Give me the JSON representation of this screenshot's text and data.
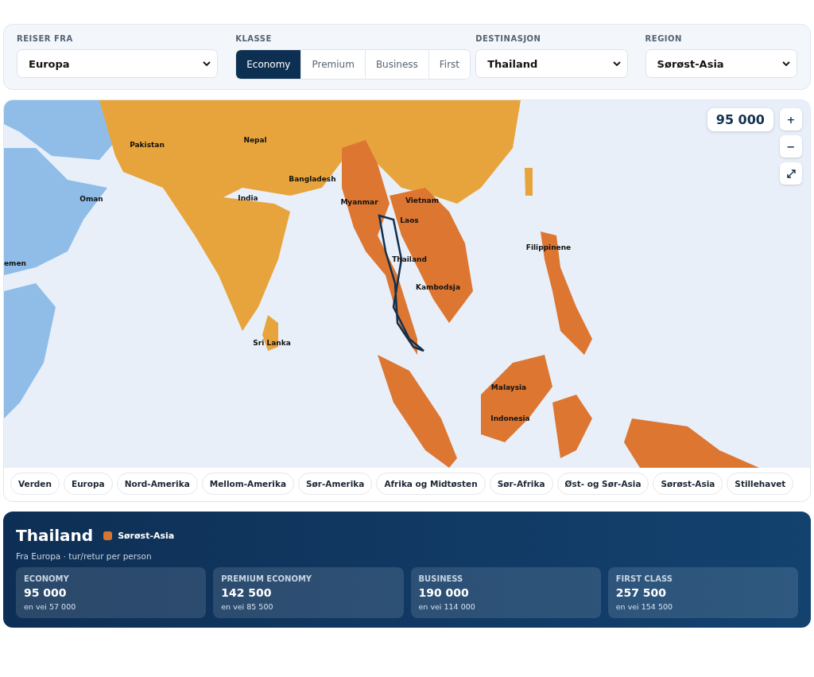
{
  "filters": {
    "origin": {
      "label": "REISER FRA",
      "value": "Europa"
    },
    "class": {
      "label": "KLASSE",
      "options": [
        {
          "label": "Economy",
          "selected": true
        },
        {
          "label": "Premium",
          "selected": false
        },
        {
          "label": "Business",
          "selected": false
        },
        {
          "label": "First",
          "selected": false
        }
      ]
    },
    "destination": {
      "label": "DESTINASJON",
      "value": "Thailand"
    },
    "region": {
      "label": "REGION",
      "value": "Sørøst-Asia"
    }
  },
  "map": {
    "price_badge": "95 000",
    "controls": [
      "+",
      "−"
    ],
    "labels": [
      "Pakistan",
      "Nepal",
      "Oman",
      "India",
      "Bangladesh",
      "Myanmar",
      "Vietnam",
      "Laos",
      "Thailand",
      "Kambodsja",
      "Filippinene",
      "emen",
      "Sri Lanka",
      "Malaysia",
      "Indonesia"
    ],
    "region_tabs": [
      {
        "label": "Verden",
        "selected": false
      },
      {
        "label": "Europa",
        "selected": false
      },
      {
        "label": "Nord-Amerika",
        "selected": false
      },
      {
        "label": "Mellom-Amerika",
        "selected": false
      },
      {
        "label": "Sør-Amerika",
        "selected": false
      },
      {
        "label": "Afrika og Midtøsten",
        "selected": false
      },
      {
        "label": "Sør-Afrika",
        "selected": false
      },
      {
        "label": "Øst- og Sør-Asia",
        "selected": false
      },
      {
        "label": "Sørøst-Asia",
        "selected": false
      },
      {
        "label": "Stillehavet",
        "selected": false
      }
    ]
  },
  "summary": {
    "title": "Thailand",
    "region": {
      "label": "Sørøst-Asia",
      "color": "#d9742f"
    },
    "subtitle": "Fra Europa · tur/retur per person",
    "prices": [
      {
        "label": "ECONOMY",
        "value": "95 000",
        "one_way": "en vei 57 000"
      },
      {
        "label": "PREMIUM ECONOMY",
        "value": "142 500",
        "one_way": "en vei 85 500"
      },
      {
        "label": "BUSINESS",
        "value": "190 000",
        "one_way": "en vei 114 000"
      },
      {
        "label": "FIRST CLASS",
        "value": "257 500",
        "one_way": "en vei 154 500"
      }
    ]
  }
}
